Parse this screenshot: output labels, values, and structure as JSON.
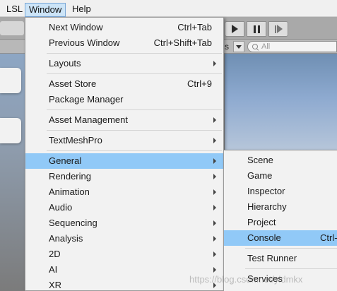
{
  "menubar": {
    "items": [
      "LSL",
      "Window",
      "Help"
    ]
  },
  "subbar": {
    "fragment": "s",
    "search_placeholder": "All"
  },
  "window_menu": {
    "items": [
      {
        "label": "Next Window",
        "shortcut": "Ctrl+Tab"
      },
      {
        "label": "Previous Window",
        "shortcut": "Ctrl+Shift+Tab"
      },
      {
        "label": "Layouts",
        "has_submenu": true
      },
      {
        "label": "Asset Store",
        "shortcut": "Ctrl+9"
      },
      {
        "label": "Package Manager"
      },
      {
        "label": "Asset Management",
        "has_submenu": true
      },
      {
        "label": "TextMeshPro",
        "has_submenu": true
      },
      {
        "label": "General",
        "has_submenu": true,
        "highlighted": true
      },
      {
        "label": "Rendering",
        "has_submenu": true
      },
      {
        "label": "Animation",
        "has_submenu": true
      },
      {
        "label": "Audio",
        "has_submenu": true
      },
      {
        "label": "Sequencing",
        "has_submenu": true
      },
      {
        "label": "Analysis",
        "has_submenu": true
      },
      {
        "label": "2D",
        "has_submenu": true
      },
      {
        "label": "AI",
        "has_submenu": true
      },
      {
        "label": "XR",
        "has_submenu": true
      }
    ]
  },
  "general_submenu": {
    "items": [
      {
        "label": "Scene"
      },
      {
        "label": "Game"
      },
      {
        "label": "Inspector"
      },
      {
        "label": "Hierarchy"
      },
      {
        "label": "Project"
      },
      {
        "label": "Console",
        "shortcut": "Ctrl-",
        "highlighted": true
      },
      {
        "label": "Test Runner"
      },
      {
        "label": "Services"
      }
    ]
  },
  "watermark": "https://blog.csdn.net/yldmkx",
  "colors": {
    "menu_highlight": "#91c9f7",
    "menu_background": "#f2f2f2",
    "menubar_active": "#cce4f7"
  },
  "icons": [
    "play-icon",
    "pause-icon",
    "step-icon",
    "dropdown-caret-icon",
    "search-icon",
    "submenu-arrow-icon"
  ]
}
